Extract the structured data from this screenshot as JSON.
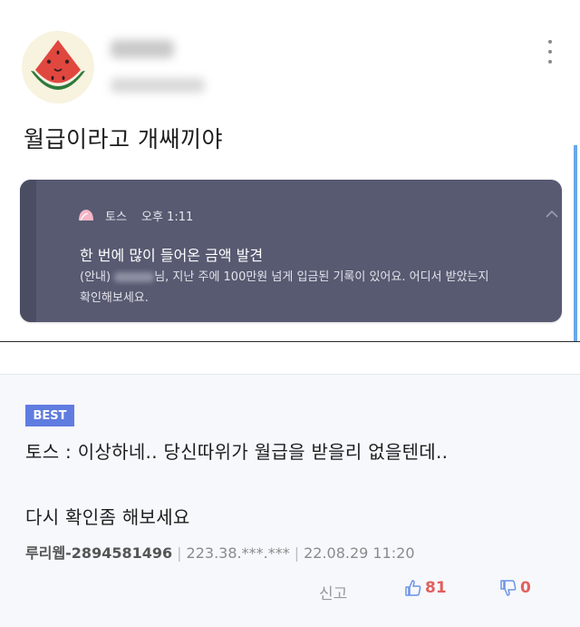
{
  "post": {
    "text": "월급이라고 개쌔끼야"
  },
  "notification": {
    "app": "토스",
    "time": "오후 1:11",
    "title": "한 번에 많이 들어온 금액 발견",
    "body_line1_prefix": "(안내) ",
    "body_line1_suffix": "님, 지난 주에 100만원 넘게 입금된 기록이 있어요. 어디서 받았는지",
    "body_line2": "확인해보세요."
  },
  "comment": {
    "badge": "BEST",
    "line1": "토스 : 이상하네.. 당신따위가 월급을 받을리 없을텐데..",
    "line2": "다시 확인좀 해보세요",
    "author": "루리웹-2894581496",
    "ip": "223.38.***.***",
    "datetime": "22.08.29 11:20",
    "separator": "|",
    "report_label": "신고",
    "likes": "81",
    "dislikes": "0"
  },
  "colors": {
    "notification_bg": "#575a71",
    "best_badge": "#5f7ce0",
    "vote_count": "#e25f5f",
    "comment_bg": "#f7f8fc"
  },
  "icons": {
    "avatar": "watermelon-icon",
    "menu": "kebab-menu-icon",
    "notification_app": "toss-app-icon",
    "collapse": "chevron-up-icon",
    "like": "thumbs-up-icon",
    "dislike": "thumbs-down-icon"
  }
}
